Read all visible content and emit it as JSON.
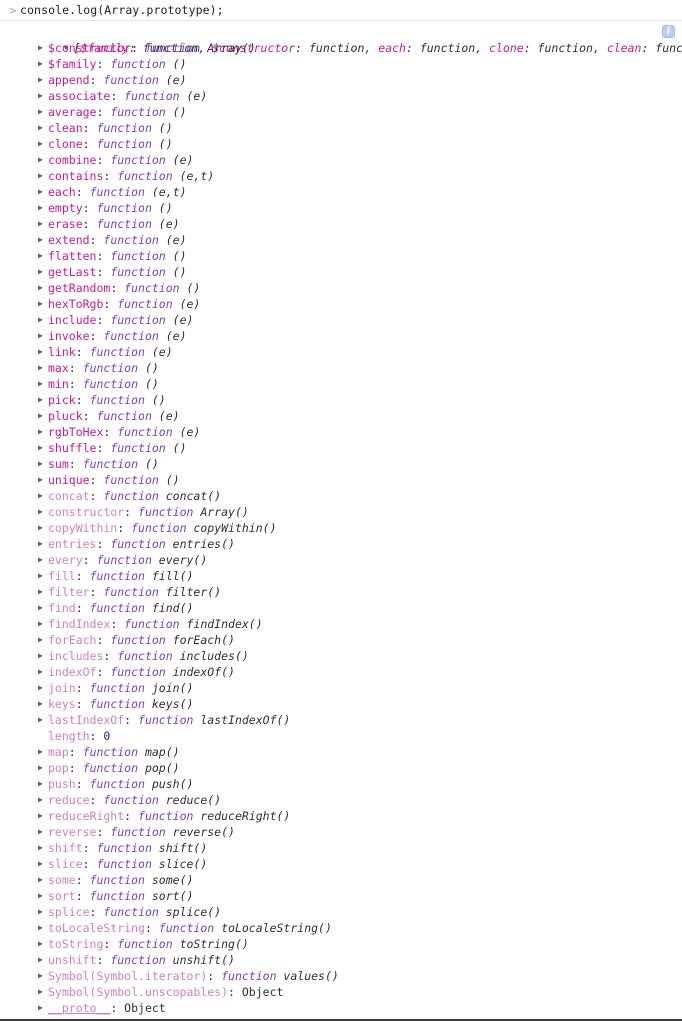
{
  "console": {
    "prompt_chevron": "chevron-right-icon",
    "input_text": "console.log(Array.prototype);",
    "info_badge": "i",
    "preview": {
      "open_bracket": "[",
      "close_bracket": "]",
      "entries": [
        {
          "key": "$family",
          "value": "function"
        },
        {
          "key": "$constructor",
          "value": "function"
        },
        {
          "key": "each",
          "value": "function"
        },
        {
          "key": "clone",
          "value": "function"
        },
        {
          "key": "clean",
          "value": "function"
        }
      ],
      "ellipsis": "…"
    },
    "properties": [
      {
        "name": "$constructor",
        "kind": "own",
        "type": "function",
        "sig": "Array()",
        "expandable": true
      },
      {
        "name": "$family",
        "kind": "own",
        "type": "function",
        "sig": "()",
        "expandable": true
      },
      {
        "name": "append",
        "kind": "own",
        "type": "function",
        "sig": "(e)",
        "expandable": true
      },
      {
        "name": "associate",
        "kind": "own",
        "type": "function",
        "sig": "(e)",
        "expandable": true
      },
      {
        "name": "average",
        "kind": "own",
        "type": "function",
        "sig": "()",
        "expandable": true
      },
      {
        "name": "clean",
        "kind": "own",
        "type": "function",
        "sig": "()",
        "expandable": true
      },
      {
        "name": "clone",
        "kind": "own",
        "type": "function",
        "sig": "()",
        "expandable": true
      },
      {
        "name": "combine",
        "kind": "own",
        "type": "function",
        "sig": "(e)",
        "expandable": true
      },
      {
        "name": "contains",
        "kind": "own",
        "type": "function",
        "sig": "(e,t)",
        "expandable": true
      },
      {
        "name": "each",
        "kind": "own",
        "type": "function",
        "sig": "(e,t)",
        "expandable": true
      },
      {
        "name": "empty",
        "kind": "own",
        "type": "function",
        "sig": "()",
        "expandable": true
      },
      {
        "name": "erase",
        "kind": "own",
        "type": "function",
        "sig": "(e)",
        "expandable": true
      },
      {
        "name": "extend",
        "kind": "own",
        "type": "function",
        "sig": "(e)",
        "expandable": true
      },
      {
        "name": "flatten",
        "kind": "own",
        "type": "function",
        "sig": "()",
        "expandable": true
      },
      {
        "name": "getLast",
        "kind": "own",
        "type": "function",
        "sig": "()",
        "expandable": true
      },
      {
        "name": "getRandom",
        "kind": "own",
        "type": "function",
        "sig": "()",
        "expandable": true
      },
      {
        "name": "hexToRgb",
        "kind": "own",
        "type": "function",
        "sig": "(e)",
        "expandable": true
      },
      {
        "name": "include",
        "kind": "own",
        "type": "function",
        "sig": "(e)",
        "expandable": true
      },
      {
        "name": "invoke",
        "kind": "own",
        "type": "function",
        "sig": "(e)",
        "expandable": true
      },
      {
        "name": "link",
        "kind": "own",
        "type": "function",
        "sig": "(e)",
        "expandable": true
      },
      {
        "name": "max",
        "kind": "own",
        "type": "function",
        "sig": "()",
        "expandable": true
      },
      {
        "name": "min",
        "kind": "own",
        "type": "function",
        "sig": "()",
        "expandable": true
      },
      {
        "name": "pick",
        "kind": "own",
        "type": "function",
        "sig": "()",
        "expandable": true
      },
      {
        "name": "pluck",
        "kind": "own",
        "type": "function",
        "sig": "(e)",
        "expandable": true
      },
      {
        "name": "rgbToHex",
        "kind": "own",
        "type": "function",
        "sig": "(e)",
        "expandable": true
      },
      {
        "name": "shuffle",
        "kind": "own",
        "type": "function",
        "sig": "()",
        "expandable": true
      },
      {
        "name": "sum",
        "kind": "own",
        "type": "function",
        "sig": "()",
        "expandable": true
      },
      {
        "name": "unique",
        "kind": "own",
        "type": "function",
        "sig": "()",
        "expandable": true
      },
      {
        "name": "concat",
        "kind": "native",
        "type": "function",
        "sig": "concat()",
        "expandable": true
      },
      {
        "name": "constructor",
        "kind": "native",
        "type": "function",
        "sig": "Array()",
        "expandable": true
      },
      {
        "name": "copyWithin",
        "kind": "native",
        "type": "function",
        "sig": "copyWithin()",
        "expandable": true
      },
      {
        "name": "entries",
        "kind": "native",
        "type": "function",
        "sig": "entries()",
        "expandable": true
      },
      {
        "name": "every",
        "kind": "native",
        "type": "function",
        "sig": "every()",
        "expandable": true
      },
      {
        "name": "fill",
        "kind": "native",
        "type": "function",
        "sig": "fill()",
        "expandable": true
      },
      {
        "name": "filter",
        "kind": "native",
        "type": "function",
        "sig": "filter()",
        "expandable": true
      },
      {
        "name": "find",
        "kind": "native",
        "type": "function",
        "sig": "find()",
        "expandable": true
      },
      {
        "name": "findIndex",
        "kind": "native",
        "type": "function",
        "sig": "findIndex()",
        "expandable": true
      },
      {
        "name": "forEach",
        "kind": "native",
        "type": "function",
        "sig": "forEach()",
        "expandable": true
      },
      {
        "name": "includes",
        "kind": "native",
        "type": "function",
        "sig": "includes()",
        "expandable": true
      },
      {
        "name": "indexOf",
        "kind": "native",
        "type": "function",
        "sig": "indexOf()",
        "expandable": true
      },
      {
        "name": "join",
        "kind": "native",
        "type": "function",
        "sig": "join()",
        "expandable": true
      },
      {
        "name": "keys",
        "kind": "native",
        "type": "function",
        "sig": "keys()",
        "expandable": true
      },
      {
        "name": "lastIndexOf",
        "kind": "native",
        "type": "function",
        "sig": "lastIndexOf()",
        "expandable": true
      },
      {
        "name": "length",
        "kind": "native",
        "type": "number",
        "sig": "0",
        "expandable": false
      },
      {
        "name": "map",
        "kind": "native",
        "type": "function",
        "sig": "map()",
        "expandable": true
      },
      {
        "name": "pop",
        "kind": "native",
        "type": "function",
        "sig": "pop()",
        "expandable": true
      },
      {
        "name": "push",
        "kind": "native",
        "type": "function",
        "sig": "push()",
        "expandable": true
      },
      {
        "name": "reduce",
        "kind": "native",
        "type": "function",
        "sig": "reduce()",
        "expandable": true
      },
      {
        "name": "reduceRight",
        "kind": "native",
        "type": "function",
        "sig": "reduceRight()",
        "expandable": true
      },
      {
        "name": "reverse",
        "kind": "native",
        "type": "function",
        "sig": "reverse()",
        "expandable": true
      },
      {
        "name": "shift",
        "kind": "native",
        "type": "function",
        "sig": "shift()",
        "expandable": true
      },
      {
        "name": "slice",
        "kind": "native",
        "type": "function",
        "sig": "slice()",
        "expandable": true
      },
      {
        "name": "some",
        "kind": "native",
        "type": "function",
        "sig": "some()",
        "expandable": true
      },
      {
        "name": "sort",
        "kind": "native",
        "type": "function",
        "sig": "sort()",
        "expandable": true
      },
      {
        "name": "splice",
        "kind": "native",
        "type": "function",
        "sig": "splice()",
        "expandable": true
      },
      {
        "name": "toLocaleString",
        "kind": "native",
        "type": "function",
        "sig": "toLocaleString()",
        "expandable": true
      },
      {
        "name": "toString",
        "kind": "native",
        "type": "function",
        "sig": "toString()",
        "expandable": true
      },
      {
        "name": "unshift",
        "kind": "native",
        "type": "function",
        "sig": "unshift()",
        "expandable": true
      },
      {
        "name": "Symbol(Symbol.iterator)",
        "kind": "native",
        "type": "function",
        "sig": "values()",
        "expandable": true
      },
      {
        "name": "Symbol(Symbol.unscopables)",
        "kind": "native",
        "type": "object",
        "sig": "Object",
        "expandable": true
      },
      {
        "name": "__proto__",
        "kind": "proto",
        "type": "object",
        "sig": "Object",
        "expandable": true
      }
    ]
  },
  "colors": {
    "key_own": "#c41a8f",
    "key_native": "#cd80bd",
    "function_keyword": "#7b3fb8",
    "number": "#1a1aa6",
    "text": "#303030",
    "background": "#ffffff",
    "divider": "#e6e6e6",
    "info_badge": "#b8cdf0"
  }
}
